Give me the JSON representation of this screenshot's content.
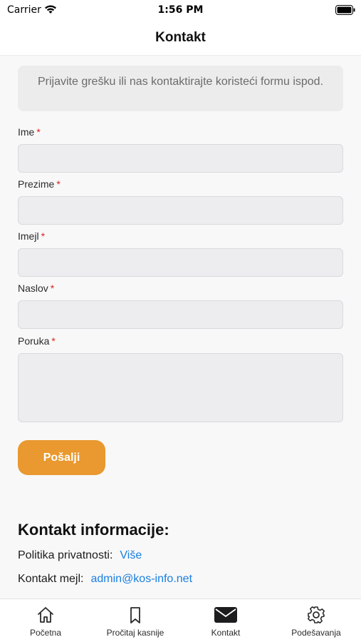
{
  "status_bar": {
    "carrier": "Carrier",
    "time": "1:56 PM"
  },
  "nav": {
    "title": "Kontakt"
  },
  "notice": {
    "text": "Prijavite grešku ili nas kontaktirajte koristeći formu ispod."
  },
  "form": {
    "required_marker": "*",
    "fields": [
      {
        "label": "Ime",
        "value": ""
      },
      {
        "label": "Prezime",
        "value": ""
      },
      {
        "label": "Imejl",
        "value": ""
      },
      {
        "label": "Naslov",
        "value": ""
      },
      {
        "label": "Poruka",
        "value": ""
      }
    ],
    "submit_label": "Pošalji"
  },
  "contact_info": {
    "heading": "Kontakt informacije:",
    "privacy_label": "Politika privatnosti:",
    "privacy_link": "Više",
    "email_label": "Kontakt mejl:",
    "email_link": "admin@kos-info.net"
  },
  "tabs": [
    {
      "label": "Početna",
      "icon": "home-icon"
    },
    {
      "label": "Pročitaj kasnije",
      "icon": "bookmark-icon"
    },
    {
      "label": "Kontakt",
      "icon": "envelope-icon"
    },
    {
      "label": "Podešavanja",
      "icon": "gear-icon"
    }
  ],
  "colors": {
    "accent": "#e9992f",
    "link": "#1a7fe0",
    "required": "#e02020"
  }
}
